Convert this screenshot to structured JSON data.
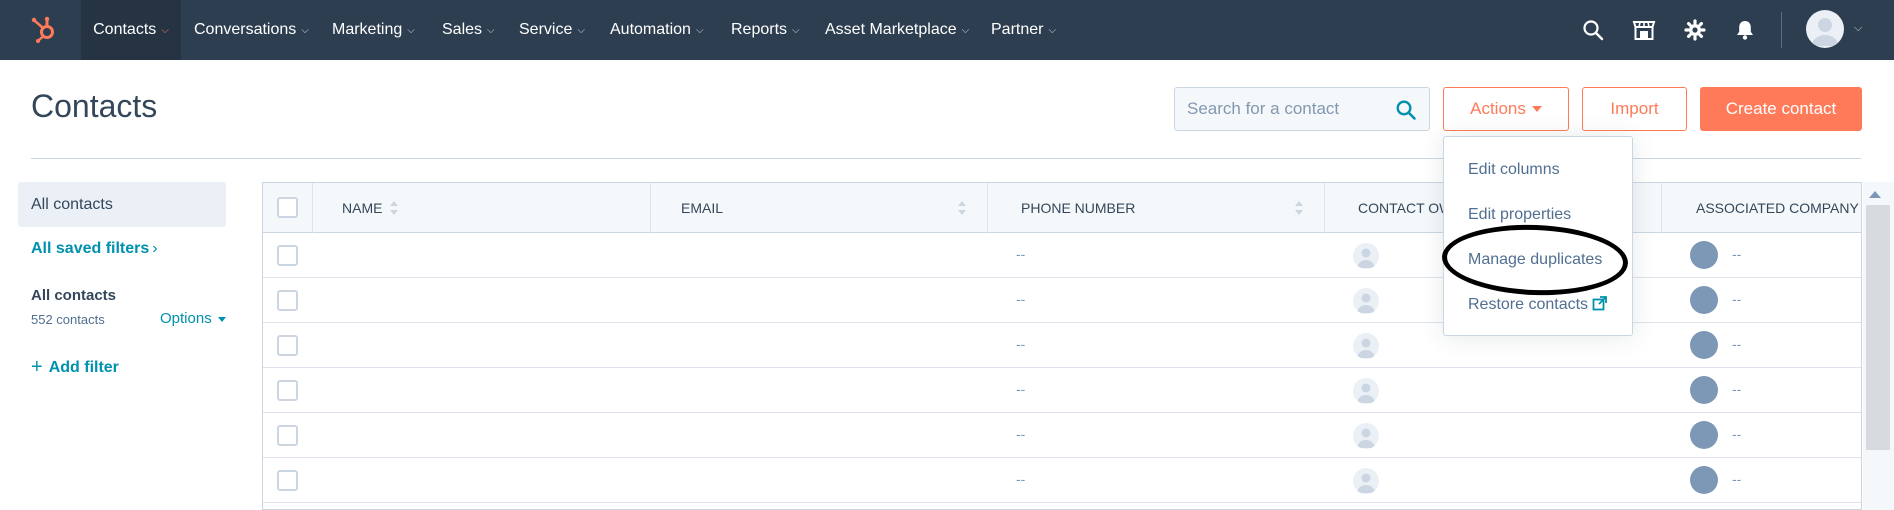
{
  "nav": {
    "items": [
      {
        "label": "Contacts"
      },
      {
        "label": "Conversations"
      },
      {
        "label": "Marketing"
      },
      {
        "label": "Sales"
      },
      {
        "label": "Service"
      },
      {
        "label": "Automation"
      },
      {
        "label": "Reports"
      },
      {
        "label": "Asset Marketplace"
      },
      {
        "label": "Partner"
      }
    ],
    "active": "Contacts",
    "icons": [
      "hubspot-logo-icon",
      "search-icon",
      "marketplace-icon",
      "gear-icon",
      "bell-icon",
      "user-avatar-icon"
    ]
  },
  "header": {
    "title": "Contacts",
    "search_placeholder": "Search for a contact",
    "actions_label": "Actions",
    "import_label": "Import",
    "create_label": "Create contact"
  },
  "sidebar": {
    "all_contacts": "All contacts",
    "saved_filters": "All saved filters",
    "view_title": "All contacts",
    "view_count": "552 contacts",
    "options": "Options",
    "add_filter": "Add filter"
  },
  "table": {
    "columns": [
      "NAME",
      "EMAIL",
      "PHONE NUMBER",
      "CONTACT OW",
      "ASSOCIATED COMPANY"
    ],
    "rows": [
      {
        "phone": "--",
        "company": "--"
      },
      {
        "phone": "--",
        "company": "--"
      },
      {
        "phone": "--",
        "company": "--"
      },
      {
        "phone": "--",
        "company": "--"
      },
      {
        "phone": "--",
        "company": "--"
      },
      {
        "phone": "--",
        "company": "--"
      }
    ]
  },
  "actions_menu": {
    "items": [
      "Edit columns",
      "Edit properties",
      "Manage duplicates",
      "Restore contacts"
    ],
    "highlighted": "Manage duplicates"
  },
  "colors": {
    "nav_bg": "#2d3e50",
    "accent": "#ff7a59",
    "link": "#0091ae",
    "text": "#33475b"
  }
}
